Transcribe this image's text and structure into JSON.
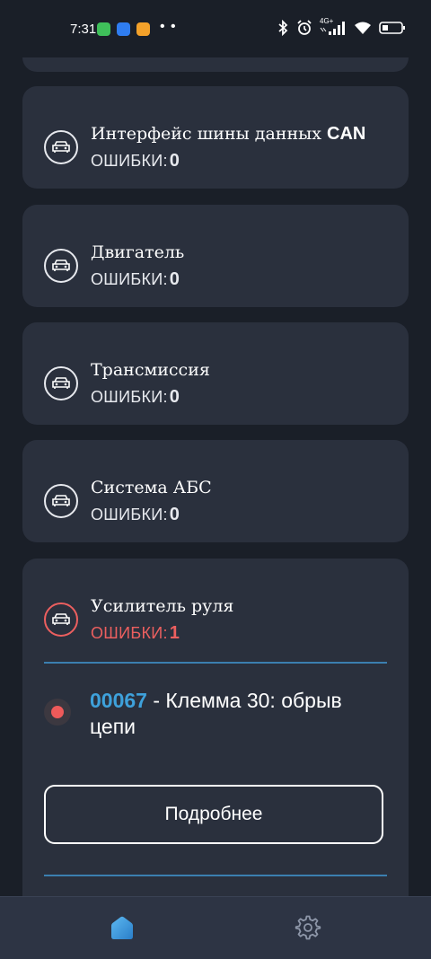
{
  "status_bar": {
    "time": "7:31",
    "app_colors": [
      "#3fbf5a",
      "#2f7df0",
      "#f3a12a"
    ],
    "dots": "• •",
    "network": "4G+"
  },
  "cards": [
    {
      "title": "Интерфейс шины данных ",
      "title_bold": "CAN",
      "errors_label": "ОШИБКИ:",
      "errors_count": "0"
    },
    {
      "title": "Двигатель",
      "errors_label": "ОШИБКИ:",
      "errors_count": "0"
    },
    {
      "title": "Трансмиссия",
      "errors_label": "ОШИБКИ:",
      "errors_count": "0"
    },
    {
      "title": "Система АБС",
      "errors_label": "ОШИБКИ:",
      "errors_count": "0"
    },
    {
      "title": "Усилитель руля",
      "errors_label": "ОШИБКИ:",
      "errors_count": "1",
      "error": {
        "code": "00067",
        "text": " - Клемма 30: обрыв цепи"
      },
      "details_button": "Подробнее"
    }
  ],
  "bottom_nav": {
    "items": [
      {
        "icon": "home-icon",
        "active": true
      },
      {
        "icon": "gear-icon",
        "active": false
      }
    ]
  },
  "colors": {
    "background": "#1a1f28",
    "card": "#2a303d",
    "accent": "#3ea1db",
    "error": "#ec5f5f",
    "divider": "#3b7fb0"
  }
}
